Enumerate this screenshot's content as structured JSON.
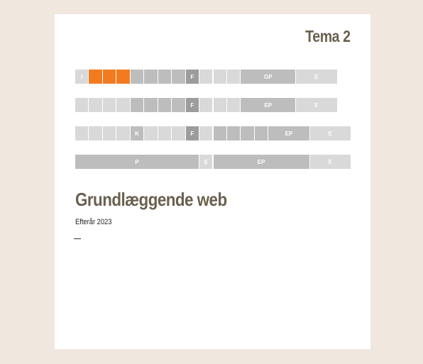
{
  "slide": {
    "title": "Tema 2",
    "heading": "Grundlæggende web",
    "subtitle": "Efterår 2023"
  },
  "colors": {
    "background": "#f0e7df",
    "title_text": "#6a604f",
    "highlight": "#f37b1f",
    "light_cell": "#d9d9d9",
    "mid_cell": "#bdbdbd",
    "dark_cell": "#9c9c9c"
  },
  "schedule": {
    "rows": [
      {
        "cells": [
          {
            "label": "I",
            "tone": "light"
          },
          {
            "label": "",
            "tone": "orange"
          },
          {
            "label": "",
            "tone": "orange"
          },
          {
            "label": "",
            "tone": "orange"
          },
          {
            "label": "",
            "tone": "mid"
          },
          {
            "label": "",
            "tone": "mid"
          },
          {
            "label": "",
            "tone": "mid"
          },
          {
            "label": "",
            "tone": "mid"
          },
          {
            "label": "F",
            "tone": "dark"
          },
          {
            "label": "",
            "tone": "light"
          },
          {
            "label": "",
            "tone": "light"
          },
          {
            "label": "",
            "tone": "light"
          },
          {
            "label": "GP",
            "tone": "mid",
            "span": 4
          },
          {
            "label": "E",
            "tone": "light",
            "span": 3
          }
        ]
      },
      {
        "cells": [
          {
            "label": "",
            "tone": "light"
          },
          {
            "label": "",
            "tone": "light"
          },
          {
            "label": "",
            "tone": "light"
          },
          {
            "label": "",
            "tone": "light"
          },
          {
            "label": "",
            "tone": "mid"
          },
          {
            "label": "",
            "tone": "mid"
          },
          {
            "label": "",
            "tone": "mid"
          },
          {
            "label": "",
            "tone": "mid"
          },
          {
            "label": "F",
            "tone": "dark"
          },
          {
            "label": "",
            "tone": "light"
          },
          {
            "label": "",
            "tone": "light"
          },
          {
            "label": "",
            "tone": "light"
          },
          {
            "label": "EP",
            "tone": "mid",
            "span": 4
          },
          {
            "label": "E",
            "tone": "light",
            "span": 3
          }
        ]
      },
      {
        "cells": [
          {
            "label": "",
            "tone": "light"
          },
          {
            "label": "",
            "tone": "light"
          },
          {
            "label": "",
            "tone": "light"
          },
          {
            "label": "",
            "tone": "light"
          },
          {
            "label": "K",
            "tone": "mid"
          },
          {
            "label": "",
            "tone": "light"
          },
          {
            "label": "",
            "tone": "light"
          },
          {
            "label": "",
            "tone": "light"
          },
          {
            "label": "F",
            "tone": "dark"
          },
          {
            "label": "",
            "tone": "light"
          },
          {
            "label": "",
            "tone": "mid"
          },
          {
            "label": "",
            "tone": "mid"
          },
          {
            "label": "",
            "tone": "mid"
          },
          {
            "label": "",
            "tone": "mid"
          },
          {
            "label": "EP",
            "tone": "mid",
            "span": 3
          },
          {
            "label": "E",
            "tone": "light",
            "span": 3
          }
        ]
      },
      {
        "cells": [
          {
            "label": "P",
            "tone": "mid",
            "span": 9
          },
          {
            "label": "E",
            "tone": "light",
            "span": 1
          },
          {
            "label": "EP",
            "tone": "mid",
            "span": 7
          },
          {
            "label": "E",
            "tone": "light",
            "span": 3
          }
        ]
      }
    ]
  }
}
